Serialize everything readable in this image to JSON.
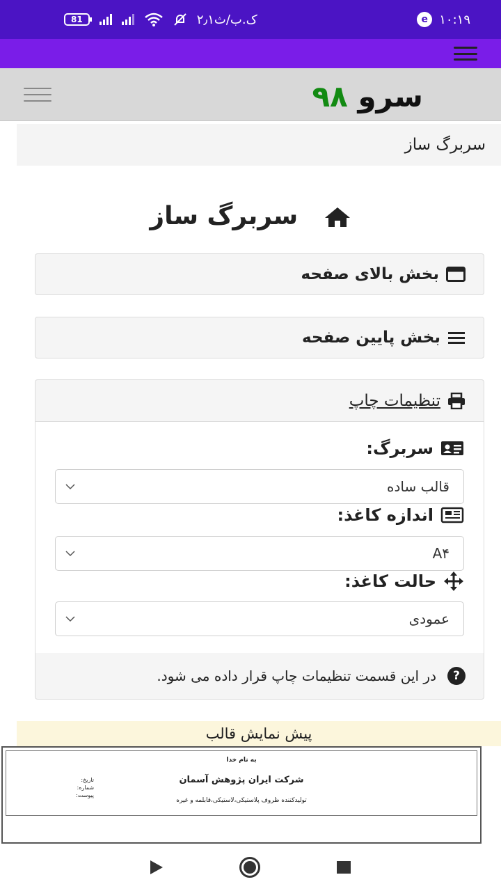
{
  "status_bar": {
    "time": "۱۰:۱۹",
    "speed": "۲٫۱ک.ب/ث",
    "battery": "81",
    "app_badge": "e"
  },
  "nav": {
    "logo_word": "سرو",
    "logo_num": "۹۸"
  },
  "breadcrumb": "سربرگ ساز",
  "page_title": "سربرگ ساز",
  "panels": {
    "header_section": "بخش بالای صفحه",
    "footer_section": "بخش پایین صفحه",
    "print_settings": "تنظیمات چاپ"
  },
  "form": {
    "letterhead_label": "سربرگ:",
    "letterhead_value": "قالب ساده",
    "paper_size_label": "اندازه کاغذ:",
    "paper_size_value": "A۴",
    "orientation_label": "حالت کاغذ:",
    "orientation_value": "عمودی"
  },
  "help_text": "در این قسمت تنظیمات چاپ قرار داده می شود.",
  "preview": {
    "label": "پیش نمایش قالب",
    "bismillah": "به نام خدا",
    "company": "شرکت ایران پژوهش آسمان",
    "subtitle": "تولیدکننده ظروف پلاستیکی،لاستیکی،قابلمه و غیره",
    "date_label": "تاریخ:",
    "number_label": "شماره:",
    "attachment_label": "پیوست:"
  },
  "colors": {
    "status_bar": "#4b14c4",
    "accent_bar": "#7a1de8",
    "nav_bg": "#d8d8d8",
    "logo_green": "#128a12",
    "preview_bar": "#fcf6dc"
  }
}
